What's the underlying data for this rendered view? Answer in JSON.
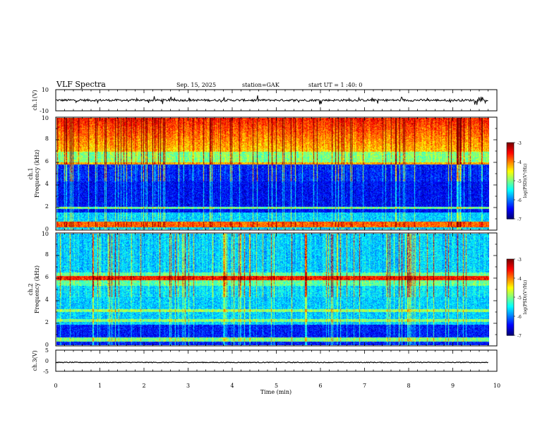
{
  "header": {
    "title": "VLF  Spectra",
    "date": "Sep. 15, 2025",
    "station": "station=GAK",
    "start": "start  UT =   1  :40: 0"
  },
  "chart_data": [
    {
      "type": "line",
      "ylabel": "ch.1(V)",
      "ylim": [
        -10,
        10
      ],
      "yticks": [
        "10",
        "-10"
      ],
      "xlim": [
        0,
        10
      ],
      "trace_level": 0,
      "series": [
        {
          "x": [
            0,
            9.8
          ],
          "y": [
            0,
            0
          ]
        }
      ]
    },
    {
      "type": "heatmap",
      "ylabel_line1": "ch.1",
      "ylabel_line2": "Frequency  (kHz)",
      "ylim": [
        0,
        10
      ],
      "yticks": [
        "0",
        "2",
        "4",
        "6",
        "8",
        "10"
      ],
      "xlim": [
        0,
        9.8
      ],
      "colorbar": {
        "label": "log(PSD)(V²/Hz)",
        "range": [
          -7,
          -3
        ],
        "ticks": [
          "-3",
          "-4",
          "-5",
          "-6",
          "-7"
        ]
      }
    },
    {
      "type": "heatmap",
      "ylabel_line1": "ch.2",
      "ylabel_line2": "Frequency  (kHz)",
      "ylim": [
        0,
        10
      ],
      "yticks": [
        "0",
        "2",
        "4",
        "6",
        "8",
        "10"
      ],
      "xlim": [
        0,
        9.8
      ],
      "colorbar": {
        "label": "log(PSD)(V²/Hz)",
        "range": [
          -7,
          -3
        ],
        "ticks": [
          "-3",
          "-4",
          "-5",
          "-6",
          "-7"
        ]
      }
    },
    {
      "type": "line",
      "ylabel": "ch.3(V)",
      "ylim": [
        -5,
        5
      ],
      "yticks": [
        "5",
        "0",
        "-5"
      ],
      "xlim": [
        0,
        10
      ],
      "trace_level": -0.8,
      "series": [
        {
          "x": [
            0,
            9.8
          ],
          "y": [
            -0.8,
            -0.8
          ]
        }
      ]
    }
  ],
  "xaxis": {
    "label": "Time  (min)",
    "range": [
      0,
      10
    ],
    "ticks": [
      "0",
      "1",
      "2",
      "3",
      "4",
      "5",
      "6",
      "7",
      "8",
      "9",
      "10"
    ]
  },
  "colors": {
    "frame": "#000000",
    "background": "#ffffff"
  }
}
